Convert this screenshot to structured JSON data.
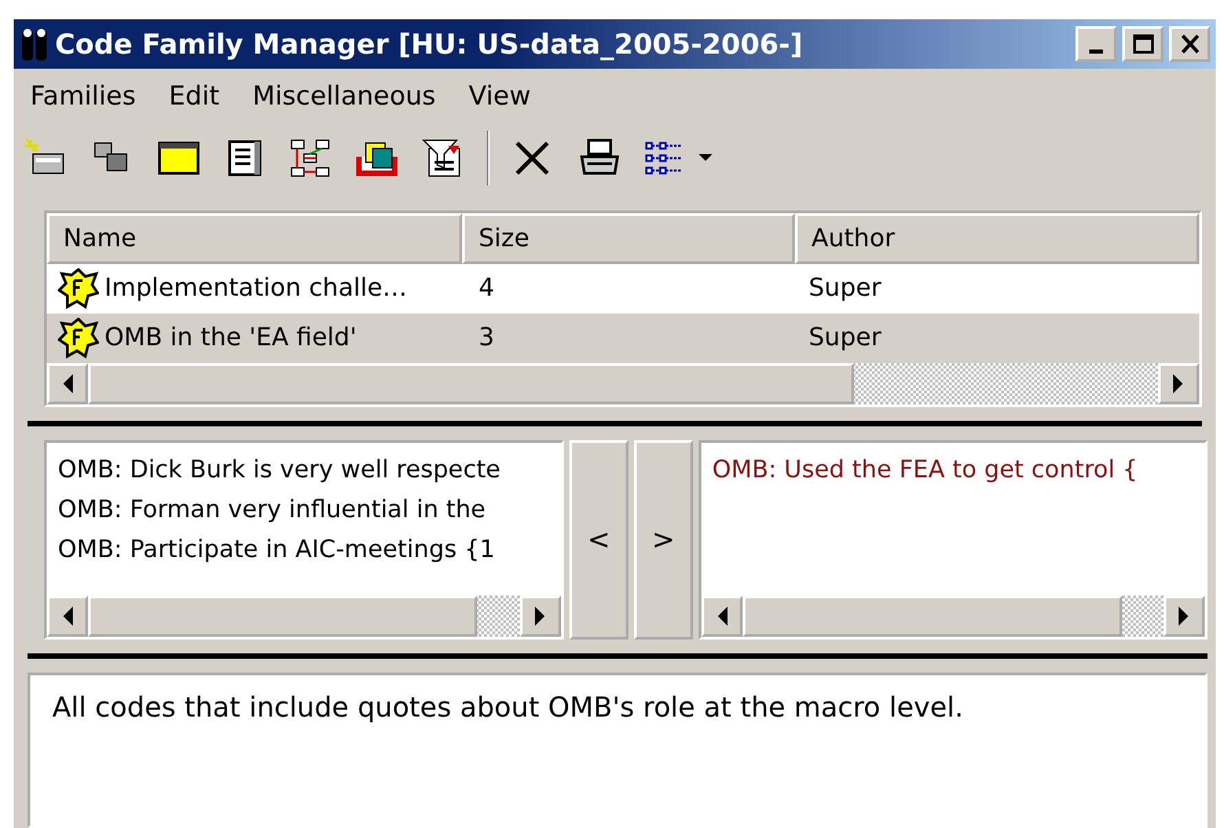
{
  "window": {
    "title": "Code Family Manager [HU: US-data_2005-2006-]"
  },
  "menu": [
    "Families",
    "Edit",
    "Miscellaneous",
    "View"
  ],
  "families": {
    "columns": [
      "Name",
      "Size",
      "Author"
    ],
    "rows": [
      {
        "name": "Implementation challe…",
        "size": "4",
        "author": "Super",
        "selected": false
      },
      {
        "name": "OMB in the 'EA field'",
        "size": "3",
        "author": "Super",
        "selected": true
      }
    ]
  },
  "non_members": [
    "OMB: Dick Burk is very well respecte",
    "OMB: Forman very influential in the",
    "OMB: Participate in AIC-meetings {1"
  ],
  "move_buttons": [
    "<",
    ">"
  ],
  "members": [
    "OMB: Used the FEA to get control {"
  ],
  "description": "All codes that include quotes about OMB's role at the macro level."
}
